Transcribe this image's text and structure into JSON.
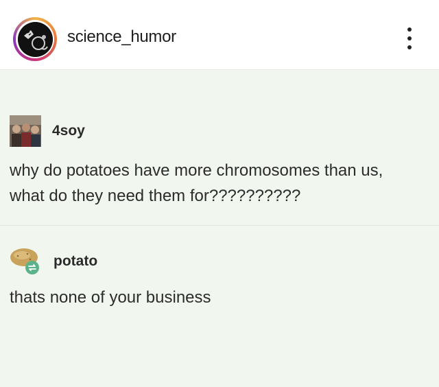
{
  "header": {
    "username": "science_humor",
    "more_icon": "vertical-ellipsis-icon"
  },
  "post": {
    "first": {
      "blog_name": "4soy",
      "text": "why do potatoes have more chromosomes than us, what do they need them for??????????"
    },
    "second": {
      "blog_name": "potato",
      "text": "thats none of your business"
    }
  }
}
